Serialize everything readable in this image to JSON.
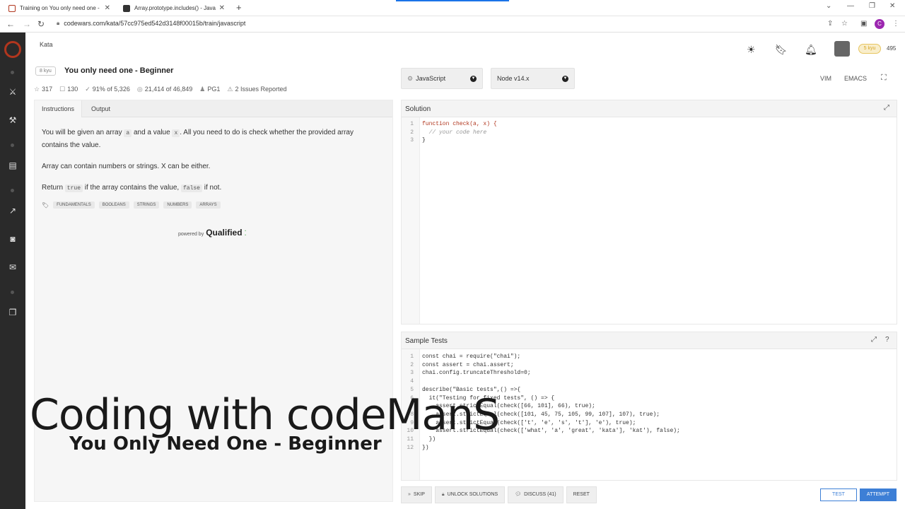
{
  "browser": {
    "tabs": [
      {
        "title": "Training on You only need one - "
      },
      {
        "title": "Array.prototype.includes() - Java"
      }
    ],
    "url": "codewars.com/kata/57cc975ed542d3148f00015b/train/javascript",
    "profile_initial": "C"
  },
  "header": {
    "breadcrumb": "Kata",
    "rank_badge": "5 kyu",
    "honor": "495"
  },
  "kata": {
    "kyu": "8 kyu",
    "title": "You only need one - Beginner",
    "stats": {
      "votes": "317",
      "favorites": "130",
      "satisfaction_pct": "91%",
      "satisfaction_of": "of 5,326",
      "completed": "21,414",
      "completed_of": "of 46,849",
      "author": "PG1",
      "issues": "2 Issues Reported"
    }
  },
  "instructions": {
    "tabs": [
      "Instructions",
      "Output"
    ],
    "p1_a": "You will be given an array ",
    "p1_code1": "a",
    "p1_b": " and a value ",
    "p1_code2": "x",
    "p1_c": ". All you need to do is check whether the provided array contains the value.",
    "p2": "Array can contain numbers or strings. X can be either.",
    "p3_a": "Return ",
    "p3_code1": "true",
    "p3_b": " if the array contains the value, ",
    "p3_code2": "false",
    "p3_c": " if not.",
    "tags": [
      "FUNDAMENTALS",
      "BOOLEANS",
      "STRINGS",
      "NUMBERS",
      "ARRAYS"
    ],
    "powered_by": "powered by",
    "brand": "Qualified"
  },
  "language": {
    "selected": "JavaScript",
    "runtime": "Node v14.x",
    "modes": [
      "VIM",
      "EMACS"
    ]
  },
  "solution": {
    "title": "Solution",
    "lines": [
      {
        "n": "1",
        "text": "function check(a, x) {"
      },
      {
        "n": "2",
        "text": "  // your code here"
      },
      {
        "n": "3",
        "text": "}"
      }
    ]
  },
  "sample_tests": {
    "title": "Sample Tests",
    "lines": [
      {
        "n": "1",
        "text": "const chai = require(\"chai\");"
      },
      {
        "n": "2",
        "text": "const assert = chai.assert;"
      },
      {
        "n": "3",
        "text": "chai.config.truncateThreshold=0;"
      },
      {
        "n": "4",
        "text": ""
      },
      {
        "n": "5",
        "text": "describe(\"Basic tests\",() =>{"
      },
      {
        "n": "6",
        "text": "  it(\"Testing for fixed tests\", () => {"
      },
      {
        "n": "7",
        "text": "    assert.strictEqual(check([66, 101], 66), true);"
      },
      {
        "n": "8",
        "text": "    assert.strictEqual(check([101, 45, 75, 105, 99, 107], 107), true);"
      },
      {
        "n": "9",
        "text": "    assert.strictEqual(check(['t', 'e', 's', 't'], 'e'), true);"
      },
      {
        "n": "10",
        "text": "    assert.strictEqual(check(['what', 'a', 'great', 'kata'], 'kat'), false);"
      },
      {
        "n": "11",
        "text": "  })"
      },
      {
        "n": "12",
        "text": "})"
      }
    ]
  },
  "actions": {
    "skip": "SKIP",
    "unlock": "UNLOCK SOLUTIONS",
    "discuss": "DISCUSS (41)",
    "reset": "RESET",
    "test": "TEST",
    "attempt": "ATTEMPT"
  },
  "overlay": {
    "headline": "Coding with codeManS",
    "subtitle": "You Only Need One - Beginner"
  },
  "colors": {
    "brand_red": "#b1361e",
    "button_blue": "#3d7fd6",
    "rank_yellow": "#d8a82b"
  }
}
